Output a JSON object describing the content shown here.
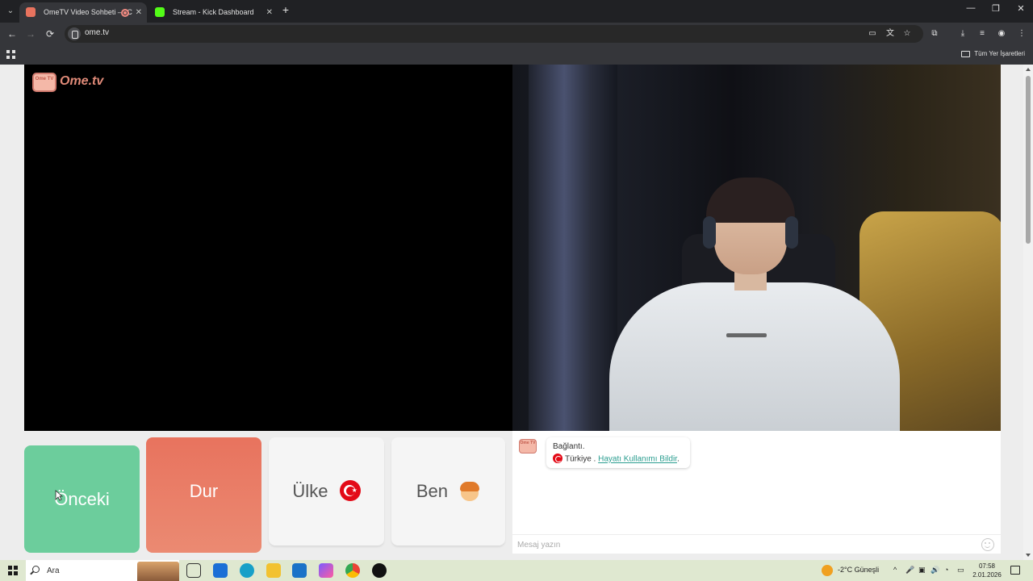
{
  "browser": {
    "tabs": [
      {
        "title": "OmeTV Video Sohbeti — C",
        "active": true,
        "favicon_color": "#e8735e"
      },
      {
        "title": "Stream - Kick Dashboard",
        "active": false,
        "favicon_color": "#53fc18"
      }
    ],
    "new_tab_glyph": "+",
    "tab_close_glyph": "✕",
    "url": "ome.tv",
    "bookmarks_all": "Tüm Yer İşaretleri",
    "nav": {
      "back": "←",
      "forward": "→",
      "reload": "⟳"
    },
    "window_controls": {
      "minimize": "—",
      "restore": "❐",
      "close": "✕"
    },
    "toolbar_icons": [
      "cast-icon",
      "translate-icon",
      "star-icon",
      "extensions-icon",
      "download-icon",
      "media-icon",
      "profile-icon",
      "menu-icon"
    ]
  },
  "page": {
    "logo_badge": "Ome TV",
    "logo_text": "Ome.tv",
    "buttons": {
      "previous": "Önceki",
      "stop": "Dur",
      "country": "Ülke",
      "me": "Ben"
    },
    "chat": {
      "logo_badge": "Ome TV",
      "status": "Bağlantı.",
      "country": "Türkiye .",
      "report_link": "Hayatı Kullanımı Bildir",
      "report_suffix": ".",
      "input_placeholder": "Mesaj yazın"
    },
    "colors": {
      "previous": "#6ccd9c",
      "stop": "#e8735e",
      "neutral": "#f5f5f5",
      "link": "#2a9d8f"
    }
  },
  "taskbar": {
    "search_label": "Ara",
    "weather": "-2°C  Güneşli",
    "time": "07:58",
    "date": "2.01.2026",
    "tray_glyphs": {
      "chevron": "^",
      "mic": "🎤",
      "speaker": "🔊"
    }
  }
}
